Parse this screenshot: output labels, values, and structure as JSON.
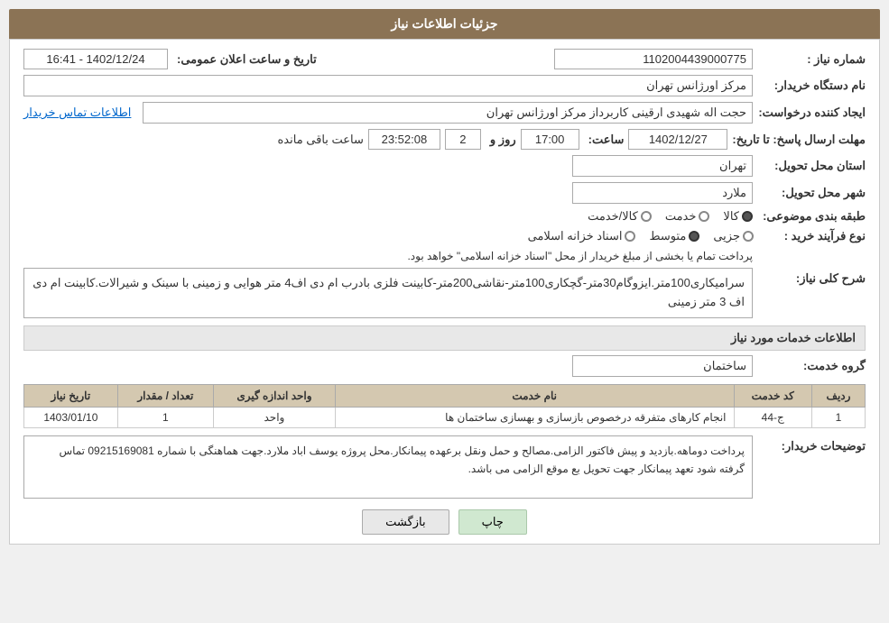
{
  "page": {
    "title": "جزئیات اطلاعات نیاز",
    "header": "جزئیات اطلاعات نیاز"
  },
  "fields": {
    "need_number_label": "شماره نیاز :",
    "need_number_value": "1102004439000775",
    "announcement_date_label": "تاریخ و ساعت اعلان عمومی:",
    "announcement_date_value": "1402/12/24 - 16:41",
    "buyer_station_label": "نام دستگاه خریدار:",
    "buyer_station_value": "مرکز اورژانس تهران",
    "requester_label": "ایجاد کننده درخواست:",
    "requester_value": "حجت اله شهیدی ارقینی کاربرداز مرکز اورژانس تهران",
    "contact_link": "اطلاعات تماس خریدار",
    "response_deadline_label": "مهلت ارسال پاسخ: تا تاریخ:",
    "response_date_value": "1402/12/27",
    "response_time_label": "ساعت:",
    "response_time_value": "17:00",
    "response_days_label": "روز و",
    "response_days_value": "2",
    "remaining_time_label": "ساعت باقی مانده",
    "remaining_time_value": "23:52:08",
    "province_label": "استان محل تحویل:",
    "province_value": "تهران",
    "city_label": "شهر محل تحویل:",
    "city_value": "ملارد",
    "category_label": "طبقه بندی موضوعی:",
    "category_options": [
      "کالا",
      "خدمت",
      "کالا/خدمت"
    ],
    "category_selected": "کالا",
    "purchase_type_label": "نوع فرآیند خرید :",
    "purchase_types": [
      "جزیی",
      "متوسط",
      "اسناد خزانه اسلامی"
    ],
    "purchase_selected": "متوسط",
    "purchase_note": "پرداخت تمام یا بخشی از مبلغ خریدار از محل \"اسناد خزانه اسلامی\" خواهد بود.",
    "need_description_label": "شرح کلی نیاز:",
    "need_description_value": "سرامیکاری100متر.ایزوگام30متر-گچکاری100متر-نقاشی200متر-کابینت فلزی بادرب ام دی اف4 متر هوایی و زمینی با سینک و شیرالات.کابینت ام دی اف 3 متر زمینی",
    "service_info_label": "اطلاعات خدمات مورد نیاز",
    "service_group_label": "گروه خدمت:",
    "service_group_value": "ساختمان",
    "table": {
      "headers": [
        "ردیف",
        "کد خدمت",
        "نام خدمت",
        "واحد اندازه گیری",
        "تعداد / مقدار",
        "تاریخ نیاز"
      ],
      "rows": [
        {
          "row": "1",
          "code": "ج-44",
          "name": "انجام کارهای متفرقه درخصوص بازسازی و بهسازی ساختمان ها",
          "unit": "واحد",
          "quantity": "1",
          "date": "1403/01/10"
        }
      ]
    },
    "buyer_comment_label": "توضیحات خریدار:",
    "buyer_comment_value": "پرداخت دوماهه.بازدید و پیش فاکتور الزامی.مصالح و حمل ونقل برعهده پیمانکار.محل پروژه یوسف اباد ملارد.جهت هماهنگی با شماره 09215169081 تماس گرفته شود تعهد پیمانکار جهت تحویل بع موقع الزامی می باشد.",
    "buttons": {
      "back": "بازگشت",
      "print": "چاپ"
    }
  }
}
